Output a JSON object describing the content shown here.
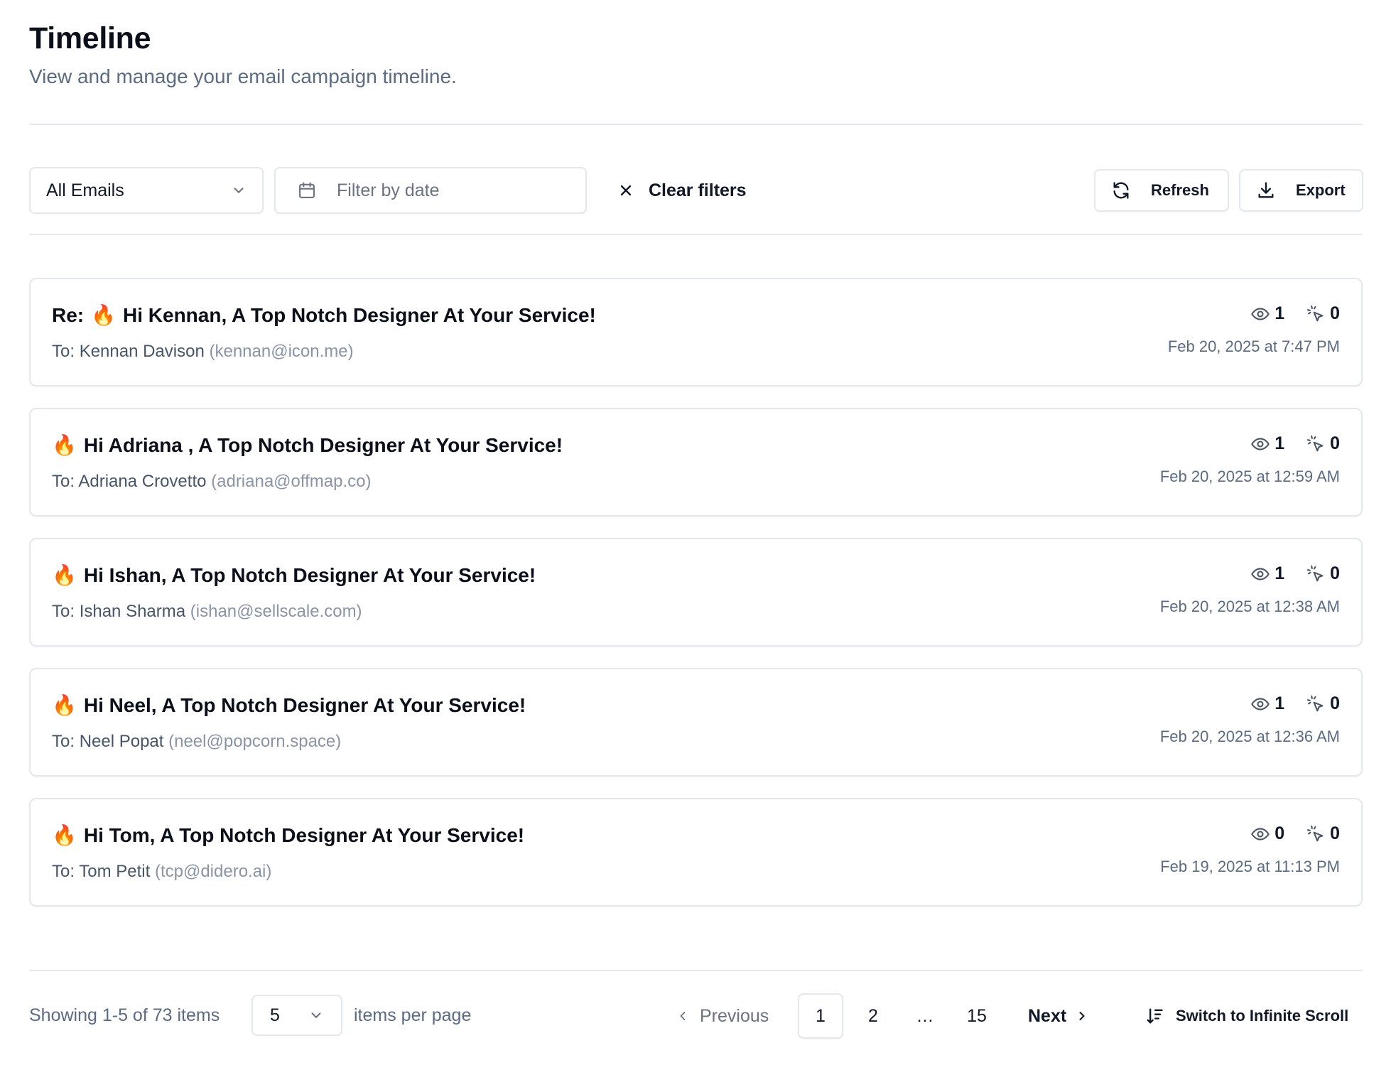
{
  "header": {
    "title": "Timeline",
    "subtitle": "View and manage your email campaign timeline."
  },
  "filters": {
    "email_filter": "All Emails",
    "date_placeholder": "Filter by date",
    "clear_label": "Clear filters"
  },
  "actions": {
    "refresh_label": "Refresh",
    "export_label": "Export"
  },
  "emails": [
    {
      "subject_prefix": "Re:",
      "subject": "Hi Kennan, A Top Notch Designer At Your Service!",
      "to_prefix": "To:",
      "recipient_name": "Kennan Davison",
      "recipient_email": "(kennan@icon.me)",
      "opens": "1",
      "clicks": "0",
      "timestamp": "Feb 20, 2025 at 7:47 PM"
    },
    {
      "subject_prefix": "",
      "subject": "Hi Adriana , A Top Notch Designer At Your Service!",
      "to_prefix": "To:",
      "recipient_name": "Adriana Crovetto",
      "recipient_email": "(adriana@offmap.co)",
      "opens": "1",
      "clicks": "0",
      "timestamp": "Feb 20, 2025 at 12:59 AM"
    },
    {
      "subject_prefix": "",
      "subject": "Hi Ishan, A Top Notch Designer At Your Service!",
      "to_prefix": "To:",
      "recipient_name": "Ishan Sharma",
      "recipient_email": "(ishan@sellscale.com)",
      "opens": "1",
      "clicks": "0",
      "timestamp": "Feb 20, 2025 at 12:38 AM"
    },
    {
      "subject_prefix": "",
      "subject": "Hi Neel, A Top Notch Designer At Your Service!",
      "to_prefix": "To:",
      "recipient_name": "Neel Popat",
      "recipient_email": "(neel@popcorn.space)",
      "opens": "1",
      "clicks": "0",
      "timestamp": "Feb 20, 2025 at 12:36 AM"
    },
    {
      "subject_prefix": "",
      "subject": "Hi Tom, A Top Notch Designer At Your Service!",
      "to_prefix": "To:",
      "recipient_name": "Tom Petit",
      "recipient_email": "(tcp@didero.ai)",
      "opens": "0",
      "clicks": "0",
      "timestamp": "Feb 19, 2025 at 11:13 PM"
    }
  ],
  "pagination": {
    "showing_text": "Showing 1-5 of 73 items",
    "per_page_value": "5",
    "per_page_label": "items per page",
    "previous_label": "Previous",
    "pages": [
      "1",
      "2",
      "…",
      "15"
    ],
    "current_page": "1",
    "next_label": "Next",
    "switch_label": "Switch to Infinite Scroll"
  },
  "icons": {
    "fire": "🔥"
  }
}
